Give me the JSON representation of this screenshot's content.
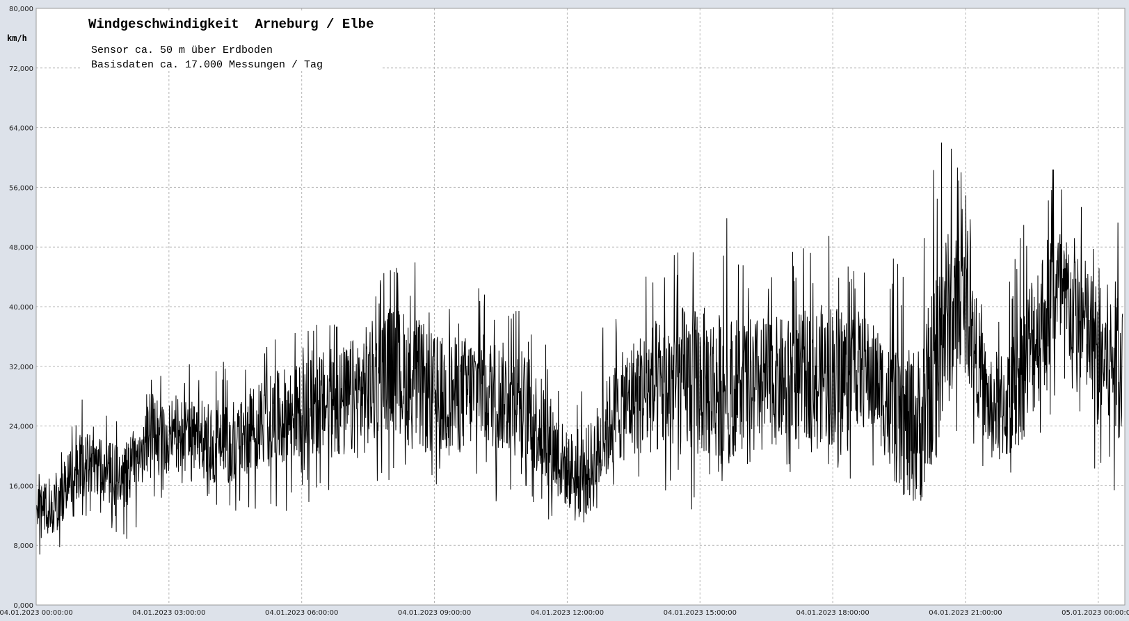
{
  "chart_data": {
    "type": "line",
    "title": "Windgeschwindigkeit  Arneburg / Elbe",
    "subtitle_lines": [
      "Sensor ca. 50 m über Erdboden",
      "Basisdaten ca. 17.000 Messungen / Tag"
    ],
    "ylabel": "km/h",
    "xlabel": "",
    "ylim": [
      0,
      80
    ],
    "y_ticks": [
      0,
      8,
      16,
      24,
      32,
      40,
      48,
      56,
      64,
      72,
      80
    ],
    "y_tick_labels": [
      "0,000",
      "8,000",
      "16,000",
      "24,000",
      "32,000",
      "40,000",
      "48,000",
      "56,000",
      "64,000",
      "72,000",
      "80,000"
    ],
    "xlim_hours": [
      0,
      24.6
    ],
    "x_tick_hours": [
      0,
      3,
      6,
      9,
      12,
      15,
      18,
      21,
      24
    ],
    "x_tick_labels": [
      "04.01.2023  00:00:00",
      "04.01.2023  03:00:00",
      "04.01.2023  06:00:00",
      "04.01.2023  09:00:00",
      "04.01.2023  12:00:00",
      "04.01.2023  15:00:00",
      "04.01.2023  18:00:00",
      "04.01.2023  21:00:00",
      "05.01.2023  00:00:00"
    ],
    "grid": true,
    "series": [
      {
        "color": "#000000",
        "x_hours": [
          0.0,
          0.5,
          1.0,
          1.5,
          2.0,
          2.5,
          3.0,
          3.5,
          4.0,
          4.5,
          5.0,
          5.5,
          6.0,
          6.5,
          7.0,
          7.5,
          8.0,
          8.5,
          9.0,
          9.5,
          10.0,
          10.5,
          11.0,
          11.5,
          12.0,
          12.5,
          13.0,
          13.5,
          14.0,
          14.5,
          15.0,
          15.5,
          16.0,
          16.5,
          17.0,
          17.5,
          18.0,
          18.5,
          19.0,
          19.5,
          20.0,
          20.5,
          21.0,
          21.5,
          22.0,
          22.5,
          23.0,
          23.5,
          24.0,
          24.5
        ],
        "mean": [
          12,
          14,
          19,
          18,
          17,
          22,
          23,
          22,
          22,
          22,
          24,
          25,
          26,
          27,
          27,
          29,
          32,
          30,
          28,
          28,
          29,
          28,
          27,
          23,
          18,
          18,
          25,
          28,
          29,
          30,
          30,
          29,
          30,
          30,
          30,
          31,
          31,
          32,
          30,
          24,
          24,
          38,
          40,
          27,
          27,
          35,
          42,
          40,
          33,
          33
        ],
        "min": [
          5,
          7,
          12,
          11,
          8,
          11,
          15,
          13,
          12,
          12,
          13,
          12,
          14,
          12,
          11,
          12,
          16,
          13,
          14,
          13,
          15,
          13,
          13,
          11,
          9,
          10,
          15,
          16,
          17,
          13,
          12,
          16,
          17,
          17,
          17,
          17,
          16,
          17,
          17,
          14,
          14,
          21,
          24,
          16,
          16,
          20,
          26,
          24,
          15,
          14
        ],
        "max": [
          17,
          22,
          28,
          26,
          24,
          30,
          35,
          33,
          34,
          32,
          34,
          36,
          38,
          38,
          40,
          44,
          46,
          47,
          44,
          42,
          43,
          40,
          40,
          36,
          28,
          33,
          40,
          45,
          51,
          50,
          49,
          53,
          48,
          49,
          48,
          49,
          52,
          46,
          44,
          48,
          55,
          67,
          56,
          40,
          46,
          58,
          61,
          58,
          51,
          53
        ]
      }
    ]
  }
}
